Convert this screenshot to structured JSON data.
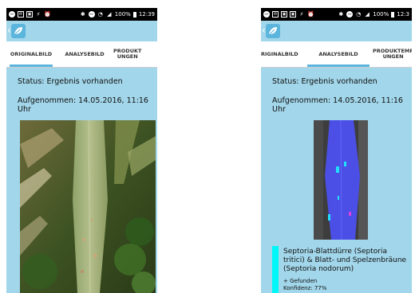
{
  "status_icons": {
    "left_phone": [
      "minus-circle-icon",
      "mail-icon",
      "image-icon",
      "plug-icon",
      "alarm-icon"
    ],
    "right_phone": [
      "minus-circle-icon",
      "mail-icon",
      "image-icon",
      "image-icon",
      "plug-icon",
      "alarm-icon"
    ]
  },
  "left": {
    "statusbar": {
      "battery": "100%",
      "time": "12:39"
    },
    "tabs": [
      {
        "label": "ORIGINALBILD",
        "active": true
      },
      {
        "label": "ANALYSEBILD",
        "active": false
      },
      {
        "label": "PRODUKT\nUNGEN",
        "active": false
      }
    ],
    "status": "Status: Ergebnis vorhanden",
    "captured_line1": "Aufgenommen: 14.05.2016, 11:16",
    "captured_line2": "Uhr"
  },
  "right": {
    "statusbar": {
      "battery": "100%",
      "time": "12:3"
    },
    "tabs": [
      {
        "label": "RIGINALBILD",
        "active": false
      },
      {
        "label": "ANALYSEBILD",
        "active": true
      },
      {
        "label": "PRODUKTEMP\nUNGEN",
        "active": false
      }
    ],
    "status": "Status: Ergebnis vorhanden",
    "captured_line1": "Aufgenommen: 14.05.2016, 11:16",
    "captured_line2": "Uhr",
    "result": {
      "line1": "Septoria-Blattdürre (Septoria",
      "line2": "tritici) & Blatt- und Spelzenbräune",
      "line3": "(Septoria nodorum)",
      "found": "+ Gefunden",
      "confidence": "Konfidenz: 77%",
      "color": "#00f7f7"
    }
  },
  "colors": {
    "background": "#a2d6ea",
    "statusbar": "#000000",
    "accent": "#5bb5dd"
  }
}
